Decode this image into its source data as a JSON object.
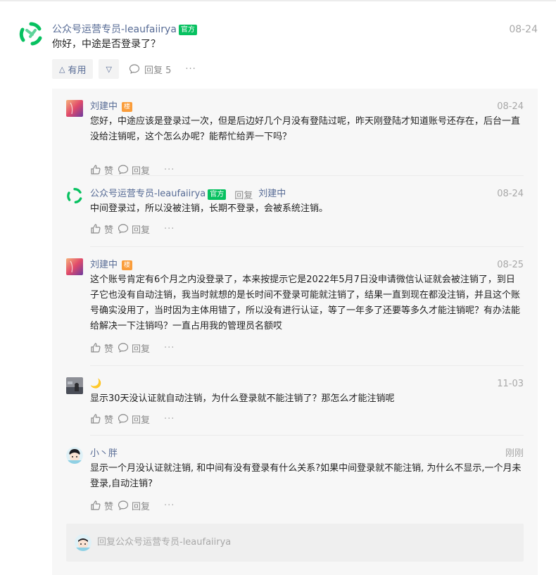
{
  "main_comment": {
    "author": "公众号运营专员-leaufaiirya",
    "badge": "官方",
    "date": "08-24",
    "text": "你好，中途是否登录了？",
    "useful_label": "有用",
    "down_icon": "▽",
    "up_icon": "△",
    "reply_label": "回复 5",
    "more_label": "···"
  },
  "replies": [
    {
      "author": "刘建中",
      "badge": "楼",
      "date": "08-24",
      "text": "您好，中途应该是登录过一次，但是后边好几个月没有登陆过呢，昨天刚登陆才知道账号还存在，后台一直没给注销呢，这个怎么办呢？能帮忙给弄一下吗？",
      "like_label": "赞",
      "reply_label": "回复",
      "more_label": "···"
    },
    {
      "author": "公众号运营专员-leaufaiirya",
      "badge": "官方",
      "reply_word": "回复",
      "reply_to": "刘建中",
      "date": "08-24",
      "text": "中间登录过，所以没被注销，长期不登录，会被系统注销。",
      "like_label": "赞",
      "reply_label": "回复",
      "more_label": "···"
    },
    {
      "author": "刘建中",
      "badge": "楼",
      "date": "08-25",
      "text": "这个账号肯定有6个月之内没登录了，本来按提示它是2022年5月7日没申请微信认证就会被注销了，到日子它也没有自动注销，我当时就想的是长时间不登录可能就注销了，结果一直到现在都没注销，并且这个账号确实没用了，当时因为主体用错了，所以没有进行认证，等了一年多了还要等多久才能注销呢？有办法能给解决一下注销吗？一直占用我的管理员名额哎",
      "like_label": "赞",
      "reply_label": "回复",
      "more_label": "···"
    },
    {
      "author": "🌙",
      "date": "11-03",
      "text": "显示30天没认证就自动注销，为什么登录就不能注销了？那怎么才能注销呢",
      "like_label": "赞",
      "reply_label": "回复",
      "more_label": "···"
    },
    {
      "author": "小丶胖",
      "date": "刚刚",
      "text": "显示一个月没认证就注销, 和中间有没有登录有什么关系?如果中间登录就不能注销, 为什么不显示,一个月未登录,自动注销?",
      "like_label": "赞",
      "reply_label": "回复",
      "more_label": "···"
    }
  ],
  "reply_input": {
    "placeholder": "回复公众号运营专员-leaufaiirya"
  },
  "colors": {
    "link": "#576b95",
    "official_badge": "#07c160",
    "louzhu_badge": "#fa9d3b",
    "reply_bg": "#f7f7f7"
  }
}
